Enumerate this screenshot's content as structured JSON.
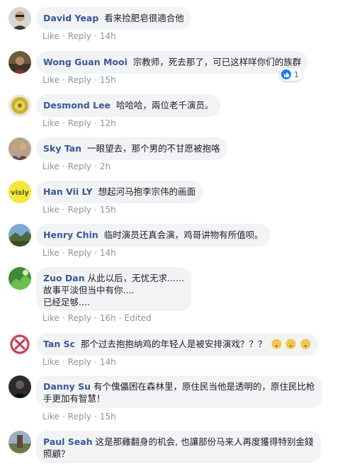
{
  "labels": {
    "like": "Like",
    "reply": "Reply",
    "dot": "·"
  },
  "comments": [
    {
      "name": "David Yeap",
      "lines": [
        "看来捡肥皂很適合他"
      ],
      "time": "14h",
      "avatar": "person-sunglasses"
    },
    {
      "name": "Wong Guan Mooi",
      "lines": [
        "宗教师，死去那了，可已这样咩你们的族群"
      ],
      "time": "15h",
      "reaction_count": "1",
      "avatar": "person-outdoor"
    },
    {
      "name": "Desmond Lee",
      "lines": [
        "哈哈哈，兩位老千演员。"
      ],
      "time": "12h",
      "avatar": "yellow-badge"
    },
    {
      "name": "Sky Tan",
      "lines": [
        "一眼望去，那个男的不甘愿被抱咯"
      ],
      "time": "2h",
      "avatar": "group-photo"
    },
    {
      "name": "Han Vii LY",
      "lines": [
        "想起河马抱李宗伟的画面"
      ],
      "time": "15h",
      "avatar": "visly-logo",
      "avatar_text": "visly"
    },
    {
      "name": "Henry Chin",
      "lines": [
        "临时演员还真会演，鸡哥讲物有所值呗。"
      ],
      "time": "14h",
      "avatar": "landscape"
    },
    {
      "name": "Zuo Dan",
      "lines": [
        "从此以后，无忧无求......",
        "故事平淡但当中有你....",
        "已经足够...."
      ],
      "time": "16h",
      "edited": "Edited",
      "avatar": "green-nature"
    },
    {
      "name": "Tan Sc",
      "lines": [
        "那个过去抱抱纳鸡的年轻人是被安排演戏？？？"
      ],
      "time": "14h",
      "emoji_count": 3,
      "avatar": "pink-cross"
    },
    {
      "name": "Danny Su",
      "lines": [
        "有个傀儡困在森林里，原住民当他是透明的，原住民比枪",
        "手更加有智慧！"
      ],
      "time": "15h",
      "avatar": "dark-person"
    },
    {
      "name": "Paul Seah",
      "lines": [
        "这是那雞翻身的机会, 也讓部份马来人再度獲得特别金錢",
        "照顧？"
      ],
      "time": "",
      "avatar": "outdoor-statue"
    }
  ]
}
